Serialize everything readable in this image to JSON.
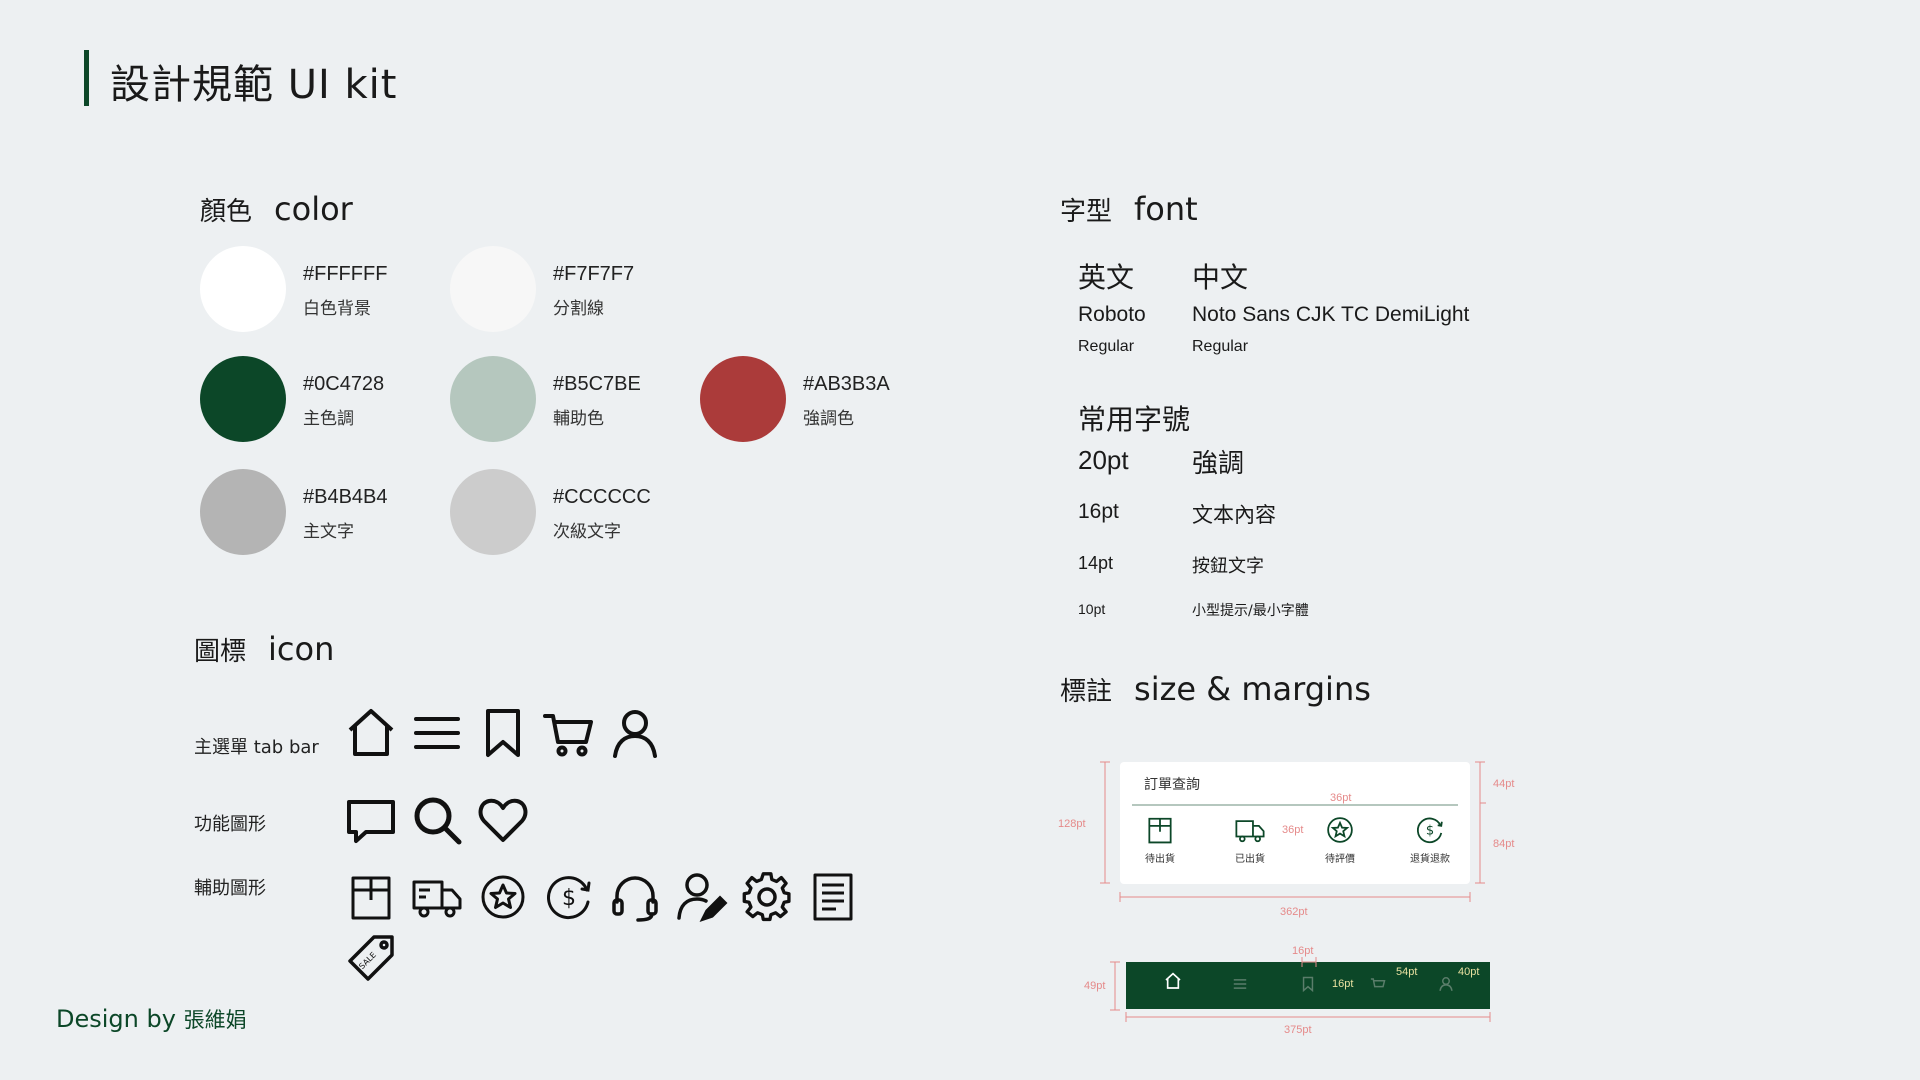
{
  "title": "設計規範 UI kit",
  "color_section": {
    "title_zh": "顏色",
    "title_en": "color",
    "swatches": [
      {
        "hex": "#FFFFFF",
        "name": "白色背景",
        "color": "#FFFFFF"
      },
      {
        "hex": "#F7F7F7",
        "name": "分割線",
        "color": "#F7F7F7"
      },
      {
        "hex": "#0C4728",
        "name": "主色調",
        "color": "#0C4728"
      },
      {
        "hex": "#B5C7BE",
        "name": "輔助色",
        "color": "#B5C7BE"
      },
      {
        "hex": "#AB3B3A",
        "name": "強調色",
        "color": "#AB3B3A"
      },
      {
        "hex": "#B4B4B4",
        "name": "主文字",
        "color": "#B4B4B4"
      },
      {
        "hex": "#CCCCCC",
        "name": "次級文字",
        "color": "#CCCCCC"
      }
    ]
  },
  "icon_section": {
    "title_zh": "圖標",
    "title_en": "icon",
    "rows": [
      {
        "label": "主選單 tab bar",
        "icons": [
          "home-icon",
          "menu-icon",
          "bookmark-icon",
          "cart-icon",
          "user-icon"
        ]
      },
      {
        "label": "功能圖形",
        "icons": [
          "chat-icon",
          "search-icon",
          "heart-icon"
        ]
      },
      {
        "label": "輔助圖形",
        "icons": [
          "box-icon",
          "truck-icon",
          "star-badge-icon",
          "refund-icon",
          "headset-icon",
          "user-edit-icon",
          "gear-icon",
          "document-icon",
          "sale-tag-icon"
        ]
      }
    ]
  },
  "font_section": {
    "title_zh": "字型",
    "title_en": "font",
    "english": {
      "head": "英文",
      "name": "Roboto",
      "weight": "Regular"
    },
    "chinese": {
      "head": "中文",
      "name": "Noto Sans CJK TC DemiLight",
      "weight": "Regular"
    },
    "sizes_title": "常用字號",
    "sizes": [
      {
        "size": "20pt",
        "usage": "強調"
      },
      {
        "size": "16pt",
        "usage": "文本內容"
      },
      {
        "size": "14pt",
        "usage": "按鈕文字"
      },
      {
        "size": "10pt",
        "usage": "小型提示/最小字體"
      }
    ]
  },
  "margin_section": {
    "title_zh": "標註",
    "title_en": "size & margins",
    "order_card": {
      "title": "訂單查詢",
      "items": [
        "待出貨",
        "已出貨",
        "待評價",
        "退貨退款"
      ],
      "dims": {
        "height": "128pt",
        "top": "44pt",
        "bottom": "84pt",
        "width": "362pt",
        "gap_v": "36pt",
        "gap_h": "36pt"
      }
    },
    "tab_bar": {
      "dims": {
        "height": "49pt",
        "width": "375pt",
        "top": "16pt",
        "inner": "16pt",
        "spacing": "54pt",
        "edge": "40pt"
      }
    }
  },
  "credit": {
    "prefix": "Design by",
    "name": "張維娟"
  },
  "colors": {
    "brand": "#0C4728",
    "annotation": "#E58A8A",
    "background": "#EDF0F2"
  }
}
